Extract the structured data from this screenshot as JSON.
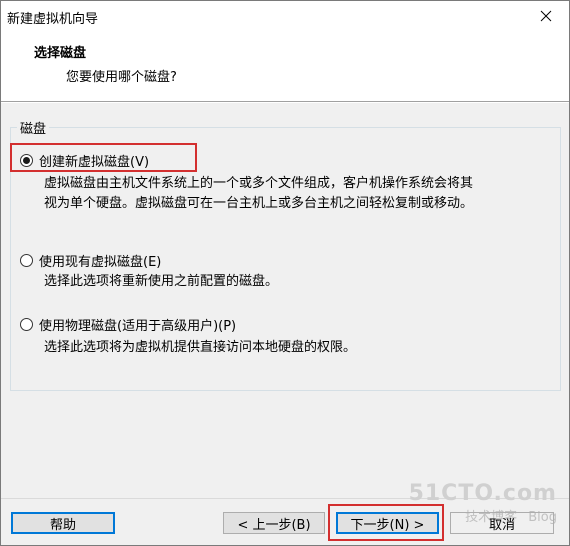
{
  "window": {
    "title": "新建虚拟机向导"
  },
  "header": {
    "title": "选择磁盘",
    "subtitle": "您要使用哪个磁盘?"
  },
  "group": {
    "label": "磁盘"
  },
  "options": [
    {
      "label": "创建新虚拟磁盘(V)",
      "checked": true,
      "description_line1": "虚拟磁盘由主机文件系统上的一个或多个文件组成，客户机操作系统会将其",
      "description_line2": "视为单个硬盘。虚拟磁盘可在一台主机上或多台主机之间轻松复制或移动。"
    },
    {
      "label": "使用现有虚拟磁盘(E)",
      "checked": false,
      "description_line1": "选择此选项将重新使用之前配置的磁盘。"
    },
    {
      "label": "使用物理磁盘(适用于高级用户)(P)",
      "checked": false,
      "description_line1": "选择此选项将为虚拟机提供直接访问本地硬盘的权限。"
    }
  ],
  "buttons": {
    "help": "帮助",
    "back": "< 上一步(B)",
    "next": "下一步(N) >",
    "cancel": "取消"
  },
  "watermark": {
    "main": "51CTO.com",
    "sub": "技术博客",
    "blog": "Blog"
  },
  "colors": {
    "highlight": "#d32f2f",
    "focus": "#0078d7"
  }
}
